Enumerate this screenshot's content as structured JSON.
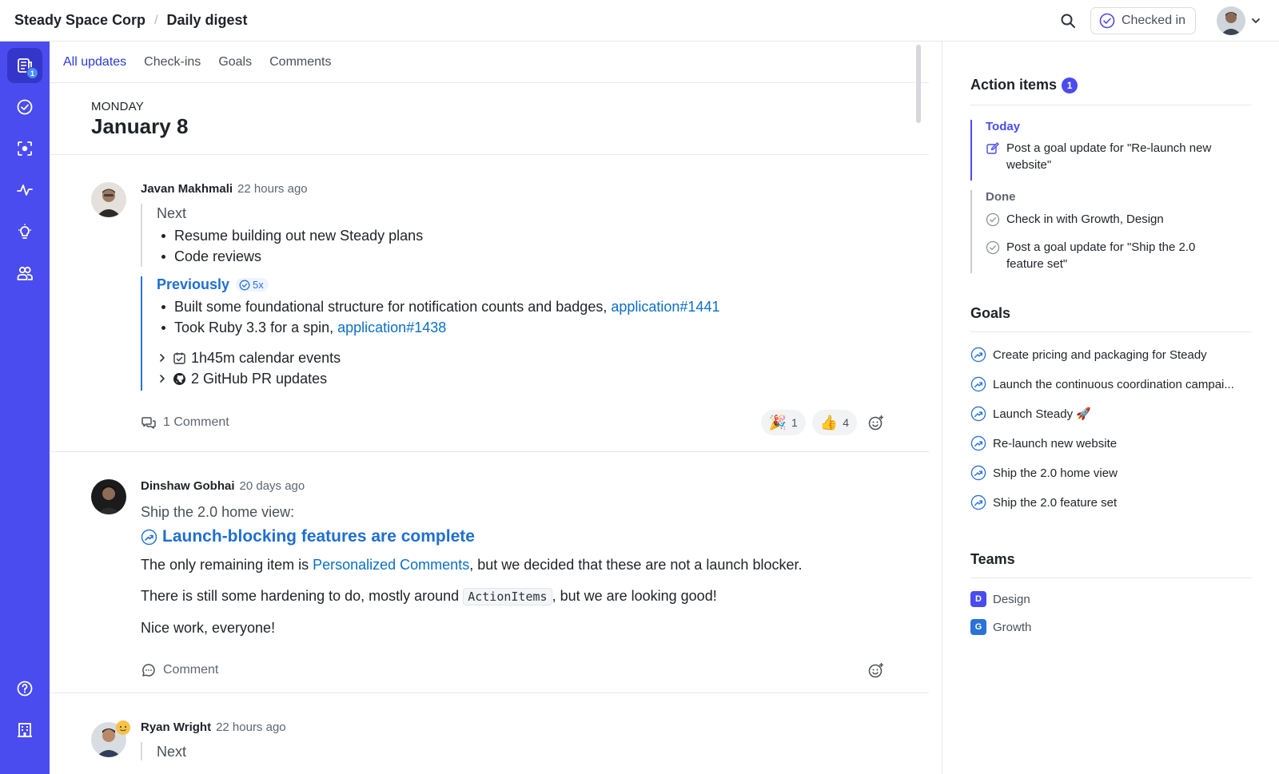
{
  "header": {
    "org": "Steady Space Corp",
    "separator": "/",
    "page": "Daily digest",
    "checked_in_label": "Checked in"
  },
  "rail": {
    "updates_badge": "1"
  },
  "tabs": [
    "All updates",
    "Check-ins",
    "Goals",
    "Comments"
  ],
  "day": {
    "name": "MONDAY",
    "date": "January 8"
  },
  "posts": {
    "javan": {
      "author": "Javan Makhmali",
      "time": "22 hours ago",
      "next_title": "Next",
      "next_items": [
        "Resume building out new Steady plans",
        "Code reviews"
      ],
      "prev_title": "Previously",
      "streak": "5x",
      "prev_item1_text": "Built some foundational structure for notification counts and badges,",
      "prev_item1_link": "application#1441",
      "prev_item2_text": "Took Ruby 3.3 for a spin,",
      "prev_item2_link": "application#1438",
      "calendar": "1h45m calendar events",
      "github": "2 GitHub PR updates",
      "comments": "1 Comment",
      "reactions": [
        {
          "emoji": "🎉",
          "count": "1"
        },
        {
          "emoji": "👍",
          "count": "4"
        }
      ]
    },
    "dinshaw": {
      "author": "Dinshaw Gobhai",
      "time": "20 days ago",
      "goal_ref": "Ship the 2.0 home view:",
      "goal_update": "Launch-blocking features are complete",
      "p1_before": "The only remaining item is",
      "p1_link": "Personalized Comments",
      "p1_after": ", but we decided that these are not a launch blocker.",
      "p2_before": "There is still some hardening to do, mostly around",
      "p2_code": "ActionItems",
      "p2_after": ", but we are looking good!",
      "p3": "Nice work, everyone!",
      "comment_label": "Comment"
    },
    "ryan": {
      "author": "Ryan Wright",
      "time": "22 hours ago",
      "next_title": "Next"
    }
  },
  "sidebar": {
    "action_items_title": "Action items",
    "action_items_count": "1",
    "today_label": "Today",
    "today_items": [
      "Post a goal update for \"Re-launch new website\""
    ],
    "done_label": "Done",
    "done_items": [
      "Check in with Growth, Design",
      "Post a goal update for \"Ship the 2.0 feature set\""
    ],
    "goals_title": "Goals",
    "goals": [
      "Create pricing and packaging for Steady",
      "Launch the continuous coordination campai...",
      "Launch Steady 🚀",
      "Re-launch new website",
      "Ship the 2.0 home view",
      "Ship the 2.0 feature set"
    ],
    "teams_title": "Teams",
    "teams": [
      {
        "initial": "D",
        "name": "Design",
        "color": "#4a4cf0"
      },
      {
        "initial": "G",
        "name": "Growth",
        "color": "#2b72d6"
      }
    ]
  },
  "colors": {
    "accent": "#4a4cf0",
    "link": "#0b6fc7",
    "rail": "#4a4cf0"
  }
}
